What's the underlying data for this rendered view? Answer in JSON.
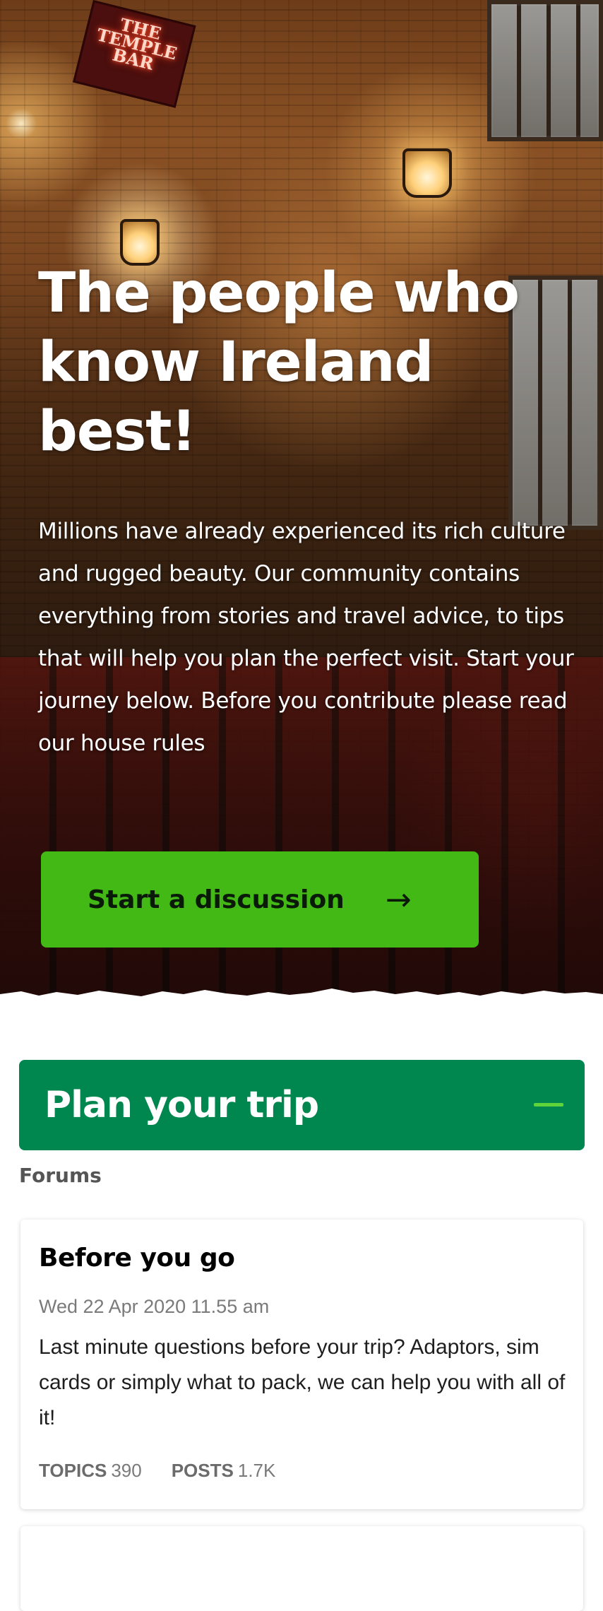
{
  "hero": {
    "sign_text": "THE TEMPLE BAR",
    "title": "The people who know Ireland best!",
    "body": "Millions have already experienced its rich culture and rugged beauty. Our community contains everything from stories and travel advice, to tips that will help you plan the perfect visit. Start your journey below. Before you contribute please read our house rules",
    "cta_label": "Start a discussion",
    "cta_icon": "arrow-right-icon"
  },
  "section": {
    "title": "Plan your trip",
    "toggle_icon": "minus-icon",
    "subheading": "Forums"
  },
  "forums": [
    {
      "title": "Before you go",
      "date": "Wed 22 Apr 2020 11.55 am",
      "description": "Last minute questions before your trip? Adaptors, sim cards or simply what to pack, we can help you with all of it!",
      "topics_label": "TOPICS",
      "topics": "390",
      "posts_label": "POSTS",
      "posts": "1.7K"
    }
  ],
  "colors": {
    "cta_green": "#43b915",
    "section_green": "#00874f",
    "toggle_green": "#5fd33a"
  }
}
